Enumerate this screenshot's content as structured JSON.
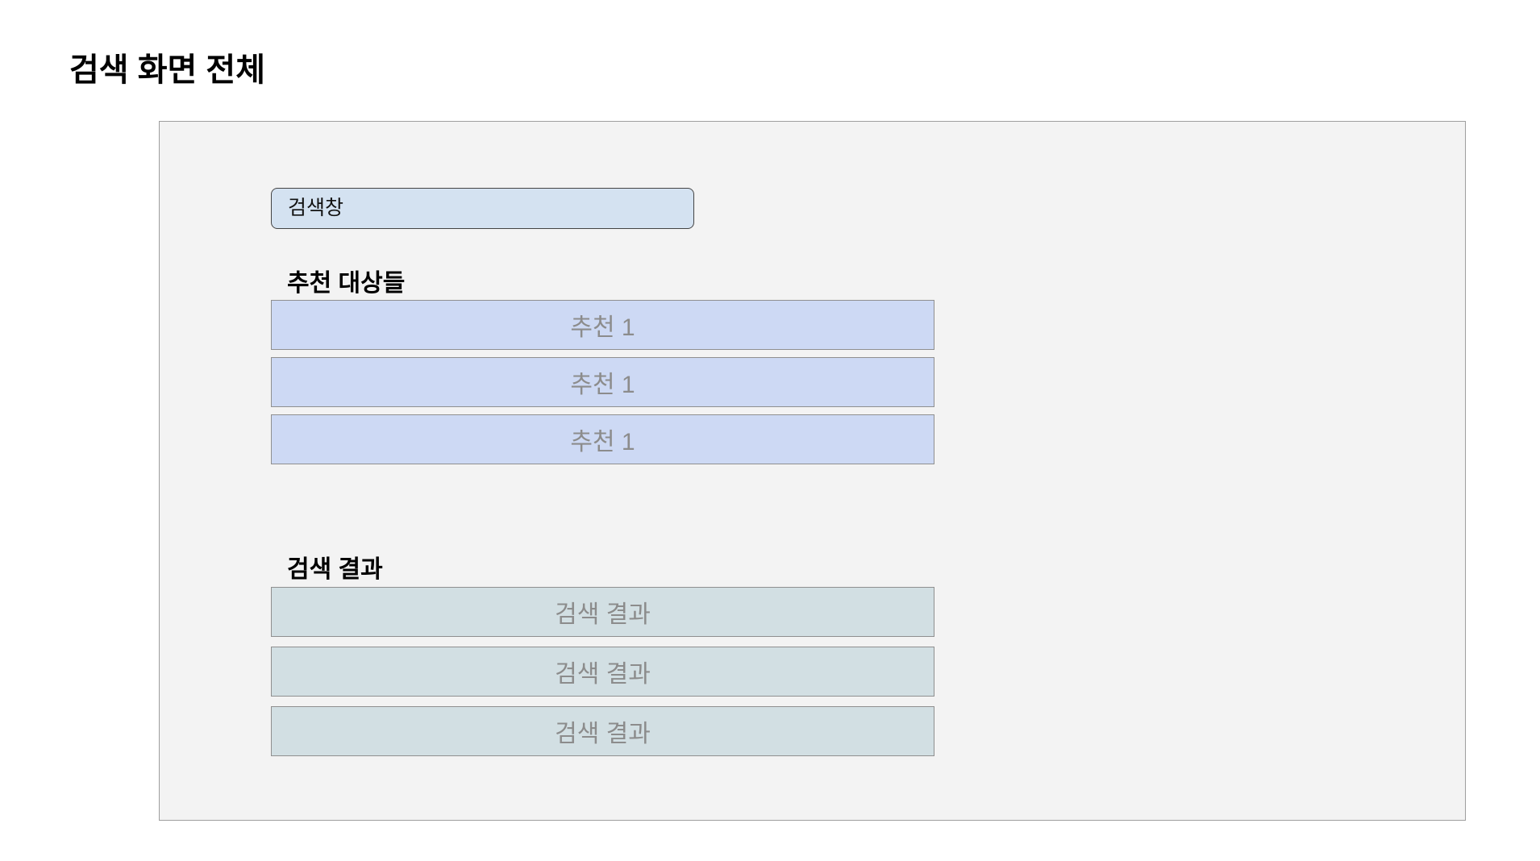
{
  "page": {
    "title": "검색 화면 전체"
  },
  "search": {
    "placeholder": "검색창"
  },
  "recommendations": {
    "label": "추천 대상들",
    "items": [
      "추천 1",
      "추천 1",
      "추천 1"
    ]
  },
  "results": {
    "label": "검색 결과",
    "items": [
      "검색 결과",
      "검색 결과",
      "검색 결과"
    ]
  },
  "colors": {
    "frame_background": "#f3f3f3",
    "search_box_fill": "#d4e2f1",
    "recommendation_fill": "#cdd9f4",
    "result_fill": "#d2dfe3",
    "item_text": "#8c8c8c"
  }
}
